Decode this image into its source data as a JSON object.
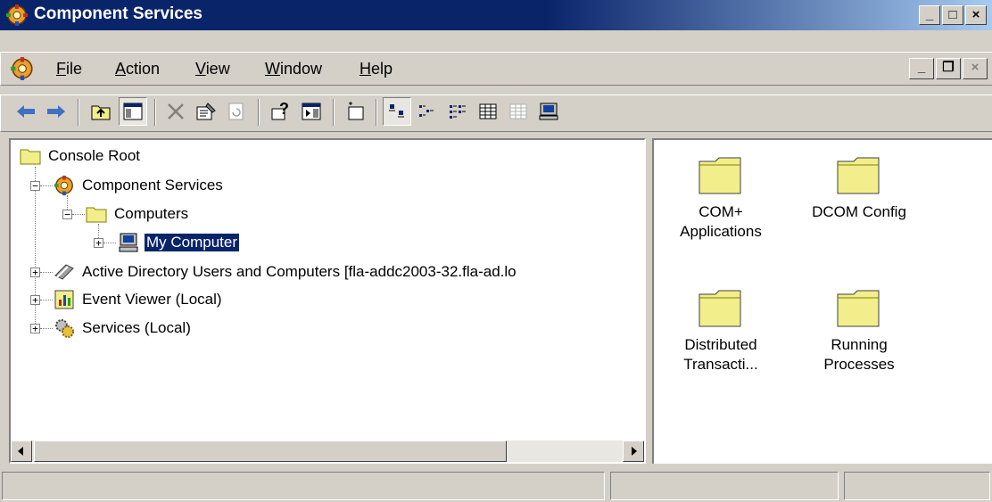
{
  "window": {
    "title": "Component Services",
    "caption_buttons": {
      "minimize": "_",
      "maximize": "□",
      "close": "×"
    }
  },
  "menu": {
    "items": [
      {
        "label": "File",
        "accel": "F",
        "rest": "ile"
      },
      {
        "label": "Action",
        "accel": "A",
        "rest": "ction"
      },
      {
        "label": "View",
        "accel": "V",
        "rest": "iew"
      },
      {
        "label": "Window",
        "accel": "W",
        "rest": "indow"
      },
      {
        "label": "Help",
        "accel": "H",
        "rest": "elp"
      }
    ],
    "mdi_buttons": {
      "minimize": "_",
      "restore": "❐",
      "close": "×"
    }
  },
  "toolbar": {
    "buttons": [
      {
        "name": "back",
        "icon": "back-arrow-icon"
      },
      {
        "name": "forward",
        "icon": "forward-arrow-icon"
      },
      {
        "name": "up-one-level",
        "icon": "up-folder-icon"
      },
      {
        "name": "show-hide-console-tree",
        "icon": "console-tree-icon",
        "active": true
      },
      {
        "name": "delete",
        "icon": "delete-x-icon"
      },
      {
        "name": "properties",
        "icon": "properties-icon"
      },
      {
        "name": "refresh",
        "icon": "refresh-icon"
      },
      {
        "name": "help",
        "icon": "help-icon"
      },
      {
        "name": "show-hide-action-pane",
        "icon": "action-pane-icon"
      },
      {
        "name": "new-window",
        "icon": "new-window-icon"
      },
      {
        "name": "large-icons",
        "icon": "large-icons-view-icon",
        "active": true
      },
      {
        "name": "small-icons",
        "icon": "small-icons-view-icon"
      },
      {
        "name": "list",
        "icon": "list-view-icon"
      },
      {
        "name": "detail",
        "icon": "detail-view-icon"
      },
      {
        "name": "configure-my-computer",
        "icon": "properties-grid-icon"
      },
      {
        "name": "computer",
        "icon": "computer-icon"
      }
    ]
  },
  "tree": {
    "nodes": [
      {
        "label": "Console Root",
        "icon": "folder-icon"
      },
      {
        "label": "Component Services",
        "icon": "component-services-icon",
        "expander": "−"
      },
      {
        "label": "Computers",
        "icon": "folder-icon",
        "expander": "−"
      },
      {
        "label": "My Computer",
        "icon": "computer-icon",
        "expander": "+",
        "selected": true
      },
      {
        "label": "Active Directory Users and Computers [fla-addc2003-32.fla-ad.lo",
        "icon": "address-book-icon",
        "expander": "+"
      },
      {
        "label": "Event Viewer (Local)",
        "icon": "event-viewer-icon",
        "expander": "+"
      },
      {
        "label": "Services (Local)",
        "icon": "services-gears-icon",
        "expander": "+"
      }
    ]
  },
  "list": {
    "items": [
      {
        "line1": "COM+",
        "line2": "Applications",
        "icon": "folder-icon"
      },
      {
        "line1": "DCOM Config",
        "line2": "",
        "icon": "folder-icon"
      },
      {
        "line1": "Distributed",
        "line2": "Transacti...",
        "icon": "folder-icon"
      },
      {
        "line1": "Running",
        "line2": "Processes",
        "icon": "folder-icon"
      }
    ]
  },
  "statusbar": {
    "panels": [
      "",
      "",
      ""
    ]
  },
  "colors": {
    "titlebar": "#0a246a",
    "face": "#d4d0c8",
    "selection": "#0a246a",
    "folder": "#f2ee8c"
  }
}
